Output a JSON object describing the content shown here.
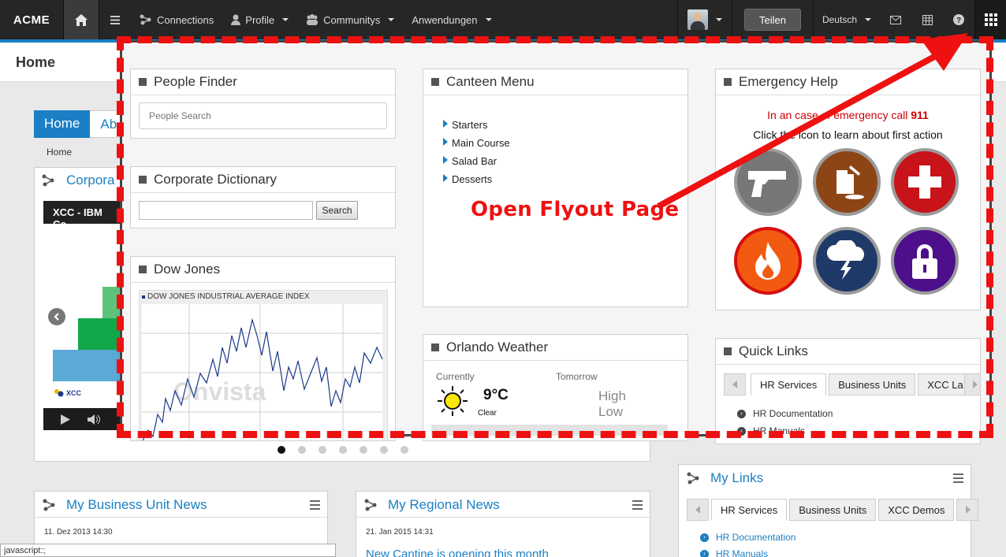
{
  "topbar": {
    "logo": "ACME",
    "nav": [
      {
        "label": "Connections"
      },
      {
        "label": "Profile"
      },
      {
        "label": "Communitys"
      },
      {
        "label": "Anwendungen"
      }
    ],
    "share_label": "Teilen",
    "language": "Deutsch"
  },
  "page": {
    "title": "Home"
  },
  "background": {
    "tabs": [
      "Home",
      "Ab"
    ],
    "breadcrumb": "Home",
    "corporate_title": "Corpora",
    "video_caption": "XCC - IBM Co",
    "xcc_logo": "XCC",
    "my_links": {
      "title": "My Links",
      "tabs": [
        "HR Services",
        "Business Units",
        "XCC Demos"
      ],
      "links": [
        "HR Documentation",
        "HR Manuals"
      ]
    },
    "business_news": {
      "title": "My Business Unit News",
      "date": "11. Dez 2013 14:30"
    },
    "regional_news": {
      "title": "My Regional News",
      "date": "21. Jan 2015 14:31",
      "headline": "New Cantine is opening this month"
    }
  },
  "flyout": {
    "people_finder": {
      "title": "People Finder",
      "placeholder": "People Search"
    },
    "dictionary": {
      "title": "Corporate Dictionary",
      "search_label": "Search"
    },
    "dow_jones": {
      "title": "Dow Jones",
      "chart_label": "DOW JONES INDUSTRIAL AVERAGE INDEX",
      "watermark": "Onvista"
    },
    "canteen": {
      "title": "Canteen Menu",
      "items": [
        "Starters",
        "Main Course",
        "Salad Bar",
        "Desserts"
      ]
    },
    "weather": {
      "title": "Orlando Weather",
      "currently_label": "Currently",
      "tomorrow_label": "Tomorrow",
      "temp": "9°C",
      "condition": "Clear",
      "high_label": "High",
      "low_label": "Low"
    },
    "emergency": {
      "title": "Emergency Help",
      "line1_prefix": "In an case of emergency call ",
      "line1_number": "911",
      "line2": "Click the icon to learn about first action"
    },
    "quick_links": {
      "title": "Quick Links",
      "tabs": [
        "HR Services",
        "Business Units",
        "XCC La"
      ],
      "links": [
        "HR Documentation",
        "HR Manuals"
      ]
    }
  },
  "annotation": {
    "label": "Open Flyout Page",
    "color": "#ee1111"
  },
  "statusbar": {
    "text": "javascript:;"
  },
  "icons": {
    "emergency": [
      "gun-icon",
      "fuel-can-icon",
      "first-aid-icon",
      "fire-icon",
      "storm-icon",
      "lock-icon"
    ],
    "apps": "apps-grid-icon"
  },
  "colors": {
    "accent": "#1a7fc4",
    "topbar": "#262626",
    "annotation": "#ee1111"
  }
}
